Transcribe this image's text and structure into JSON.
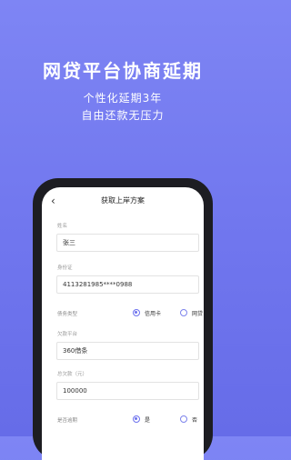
{
  "hero": {
    "title": "网贷平台协商延期",
    "subtitle_line1": "个性化延期3年",
    "subtitle_line2": "自由还款无压力"
  },
  "screen": {
    "back_glyph": "‹",
    "title": "获取上岸方案",
    "fields": {
      "name": {
        "label": "姓名",
        "value": "张三"
      },
      "id_card": {
        "label": "身份证",
        "value": "4113281985****0988"
      },
      "debt_type": {
        "label": "债务类型",
        "options": [
          "信用卡",
          "网贷"
        ],
        "selected": "信用卡"
      },
      "platform": {
        "label": "欠款平台",
        "value": "360借条"
      },
      "total_debt": {
        "label": "总欠款（元）",
        "value": "100000"
      },
      "overdue": {
        "label": "是否逾期",
        "options": [
          "是",
          "否"
        ],
        "selected": "是"
      }
    }
  },
  "colors": {
    "background": "#7076ee",
    "accent": "#6d72ee",
    "phone_frame": "#1d1d22"
  }
}
